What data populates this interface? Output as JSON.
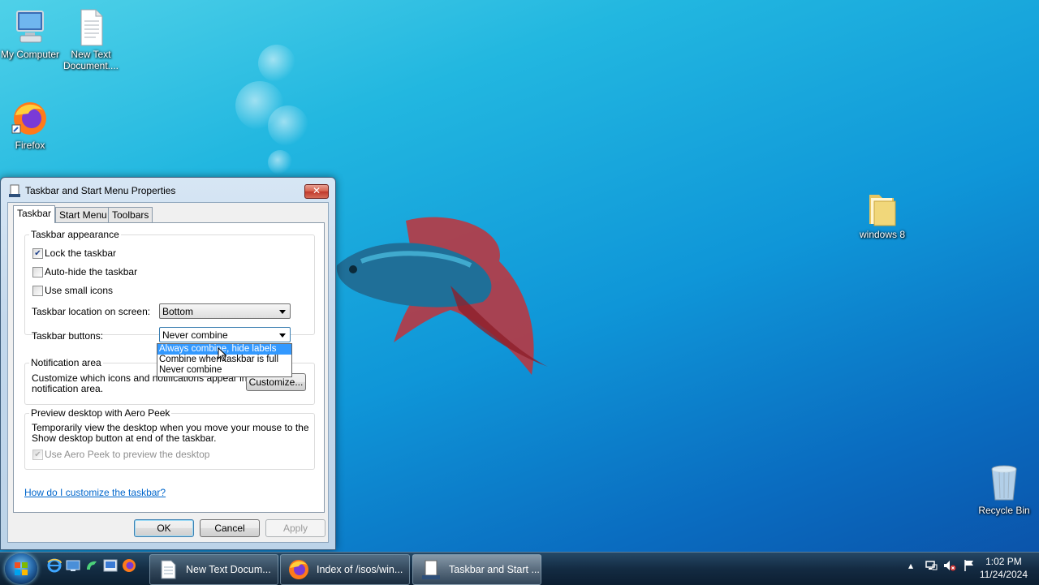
{
  "desktop": {
    "icons": [
      {
        "label": "My Computer",
        "icon": "computer-icon"
      },
      {
        "label": "New Text Document....",
        "icon": "text-document-icon"
      },
      {
        "label": "Firefox",
        "icon": "firefox-icon"
      },
      {
        "label": "windows 8",
        "icon": "folder-icon"
      },
      {
        "label": "Recycle Bin",
        "icon": "recycle-bin-icon"
      }
    ]
  },
  "dialog": {
    "title": "Taskbar and Start Menu Properties",
    "close_label": "✕",
    "tabs": [
      "Taskbar",
      "Start Menu",
      "Toolbars"
    ],
    "active_tab": "Taskbar",
    "appearance": {
      "group_title": "Taskbar appearance",
      "lock_label": "Lock the taskbar",
      "lock_checked": true,
      "autohide_label": "Auto-hide the taskbar",
      "autohide_checked": false,
      "small_icons_label": "Use small icons",
      "small_icons_checked": false,
      "location_label": "Taskbar location on screen:",
      "location_value": "Bottom",
      "buttons_label": "Taskbar buttons:",
      "buttons_value": "Never combine",
      "buttons_options": [
        "Always combine, hide labels",
        "Combine when taskbar is full",
        "Never combine"
      ],
      "buttons_highlighted": "Always combine, hide labels"
    },
    "notification": {
      "group_title": "Notification area",
      "description": "Customize which icons and notifications appear in the",
      "description_line2": "notification area.",
      "customize_label": "Customize..."
    },
    "aero_peek": {
      "group_title": "Preview desktop with Aero Peek",
      "description_line1": "Temporarily view the desktop when you move your mouse to the",
      "description_line2": "Show desktop button at end of the taskbar.",
      "checkbox_label": "Use Aero Peek to preview the desktop",
      "checked": true,
      "disabled": true
    },
    "help_link": "How do I customize the taskbar?",
    "buttons": {
      "ok": "OK",
      "cancel": "Cancel",
      "apply": "Apply"
    }
  },
  "taskbar": {
    "quick_launch": [
      "internet-explorer-icon",
      "show-desktop-icon",
      "switch-windows-icon",
      "media-icon",
      "firefox-icon"
    ],
    "windows": [
      {
        "label": "New Text Docum...",
        "icon": "notepad-icon",
        "active": false
      },
      {
        "label": "Index of /isos/win...",
        "icon": "firefox-icon",
        "active": false
      },
      {
        "label": "Taskbar and Start ...",
        "icon": "taskbar-properties-icon",
        "active": true
      }
    ],
    "tray_icons": [
      "show-hidden-icons-icon",
      "network-icon",
      "volume-muted-icon",
      "action-center-flag-icon"
    ],
    "time": "1:02 PM",
    "date": "11/24/2024"
  },
  "colors": {
    "selection": "#3399ff",
    "link": "#0066cc",
    "taskbar": "#14283c"
  }
}
